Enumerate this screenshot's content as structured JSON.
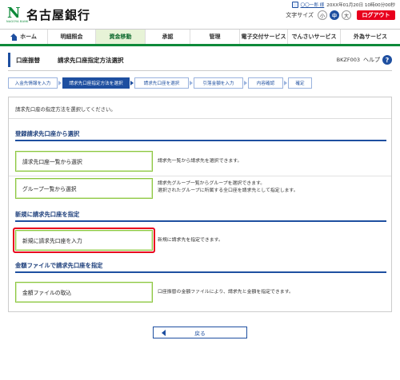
{
  "header": {
    "bank_name": "名古屋銀行",
    "logo_sub": "NAGOYA BANK",
    "user_name": "〇〇一郎 様",
    "login_time": "20XX年01月20日 10時00分00秒",
    "font_size_label": "文字サイズ",
    "font_sizes": [
      "小",
      "中",
      "大"
    ],
    "logout_label": "ログアウト"
  },
  "nav": {
    "items": [
      "ホーム",
      "明細照会",
      "資金移動",
      "承認",
      "管理",
      "電子交付サービス",
      "でんさいサービス",
      "外為サービス"
    ],
    "active_index": 2
  },
  "page": {
    "category": "口座振替",
    "title": "請求先口座指定方法選択",
    "code": "BKZF003",
    "help_label": "ヘルプ",
    "help_icon": "?"
  },
  "steps": [
    "入金先情報を入力",
    "請求先口座指定方法を選択",
    "請求先口座を選択",
    "引落金額を入力",
    "内容確認",
    "確定"
  ],
  "active_step": 1,
  "intro": "請求先口座の指定方法を選択してください。",
  "sections": {
    "registered": {
      "title": "登録請求先口座から選択",
      "list_button": "請求先口座一覧から選択",
      "list_desc": "請求先一覧から請求先を選択できます。",
      "group_button": "グループ一覧から選択",
      "group_desc_1": "請求先グループ一覧からグループを選択できます。",
      "group_desc_2": "選択されたグループに所属する全口座を請求先として指定します。"
    },
    "new": {
      "title": "新規に請求先口座を指定",
      "button": "新規に請求先口座を入力",
      "desc": "新規に請求先を指定できます。"
    },
    "file": {
      "title": "金額ファイルで請求先口座を指定",
      "button": "金額ファイルの取込",
      "desc": "口座振替の金額ファイルにより、請求先と金額を指定できます。"
    }
  },
  "back_label": "戻る",
  "colors": {
    "brand_green": "#0e8a3a",
    "primary_blue": "#1e4fa0",
    "logout_red": "#e8001d",
    "button_border_green": "#8cc63f",
    "highlight_red": "#e8001d"
  }
}
